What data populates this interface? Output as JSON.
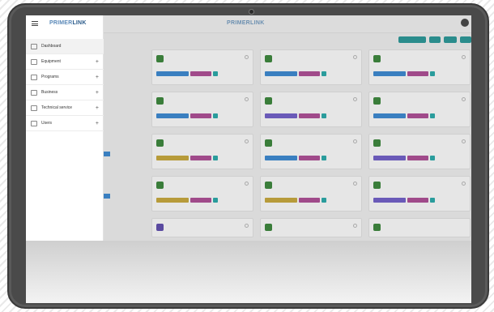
{
  "brand": {
    "primer": "PRIMER",
    "link": "LINK"
  },
  "header": {
    "center_logo": "PRIMERLINK"
  },
  "sidebar": {
    "items": [
      {
        "label": "Dashboard",
        "icon": "dashboard-icon",
        "expandable": false
      },
      {
        "label": "Equipment",
        "icon": "equipment-icon",
        "expandable": true,
        "expand": "+"
      },
      {
        "label": "Programs",
        "icon": "programs-icon",
        "expandable": true,
        "expand": "+"
      },
      {
        "label": "Business",
        "icon": "business-icon",
        "expandable": true,
        "expand": "+"
      },
      {
        "label": "Technical service",
        "icon": "wrench-icon",
        "expandable": true,
        "expand": "+"
      },
      {
        "label": "Users",
        "icon": "users-icon",
        "expandable": true,
        "expand": "+"
      }
    ]
  },
  "colors": {
    "brand_blue": "#5a88b8",
    "tag_blue": "#3a7fc0",
    "tag_gold": "#b79b3a",
    "tag_purple": "#6a5ab8",
    "tag_magenta": "#a04a8a",
    "tag_teal": "#2a9c9c",
    "action_teal": "#2a8c8c",
    "device_green": "#3a7d3a"
  }
}
